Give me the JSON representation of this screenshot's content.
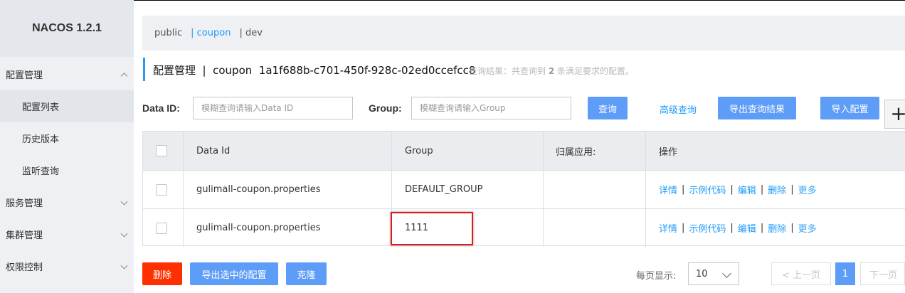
{
  "app": {
    "title": "NACOS 1.2.1"
  },
  "sidebar": {
    "groups": [
      {
        "label": "配置管理",
        "expanded": true,
        "items": [
          {
            "label": "配置列表",
            "active": true
          },
          {
            "label": "历史版本"
          },
          {
            "label": "监听查询"
          }
        ]
      },
      {
        "label": "服务管理"
      },
      {
        "label": "集群管理"
      },
      {
        "label": "权限控制"
      }
    ]
  },
  "namespaces": [
    {
      "label": "public"
    },
    {
      "label": "| coupon",
      "active": true
    },
    {
      "label": "| dev"
    }
  ],
  "header": {
    "title": "配置管理  |  coupon  1a1f688b-c701-450f-928c-02ed0ccefcc8",
    "result_prefix": "查询结果：共查询到 ",
    "result_count": "2",
    "result_suffix": " 条满足要求的配置。"
  },
  "search": {
    "dataid_label": "Data ID:",
    "dataid_placeholder": "模糊查询请输入Data ID",
    "group_label": "Group:",
    "group_placeholder": "模糊查询请输入Group",
    "query_button": "查询",
    "advanced_link": "高级查询",
    "export_button": "导出查询结果",
    "import_button": "导入配置",
    "add_button": "+"
  },
  "table": {
    "columns": [
      "Data Id",
      "Group",
      "归属应用:",
      "操作"
    ],
    "rows": [
      {
        "data_id": "gulimall-coupon.properties",
        "group": "DEFAULT_GROUP",
        "app": ""
      },
      {
        "data_id": "gulimall-coupon.properties",
        "group": "1111",
        "app": ""
      }
    ],
    "actions": [
      "详情",
      "示例代码",
      "编辑",
      "删除",
      "更多"
    ],
    "separator": "|"
  },
  "footer": {
    "delete_button": "删除",
    "export_selected_button": "导出选中的配置",
    "clone_button": "克隆",
    "page_size_label": "每页显示:",
    "page_size": "10",
    "prev_button": "< 上一页",
    "current_page": "1",
    "next_button": "下一页"
  },
  "colors": {
    "accent": "#209bfa",
    "button": "#5d9cf7",
    "danger": "#ff3000",
    "highlight_box": "#d42020"
  }
}
